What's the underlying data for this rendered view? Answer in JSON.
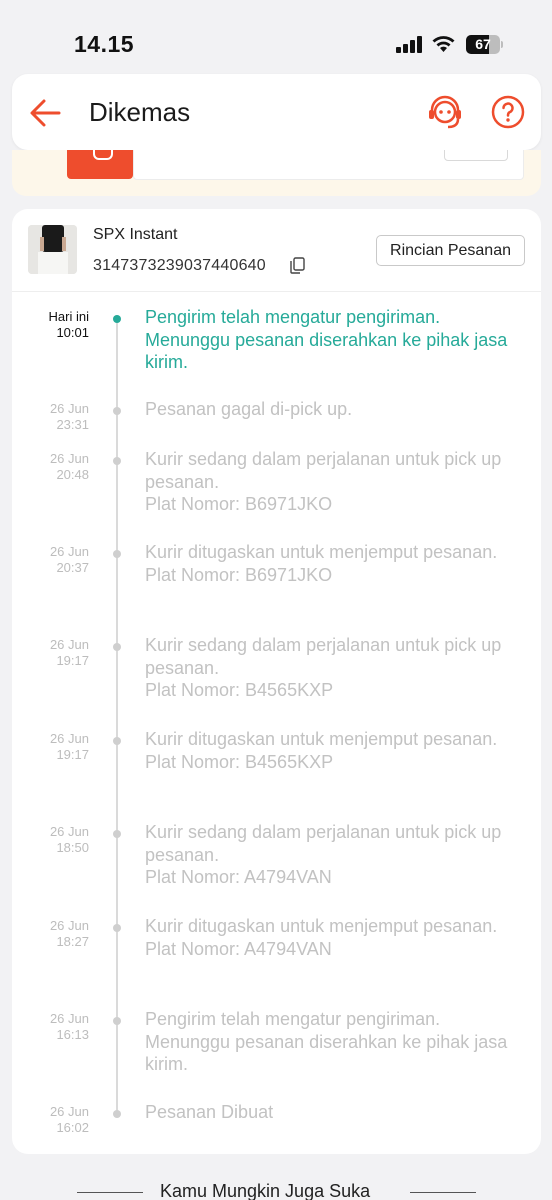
{
  "status_bar": {
    "time": "14.15",
    "battery": "67"
  },
  "header": {
    "title": "Dikemas",
    "icons": [
      "back-arrow-icon",
      "customer-service-icon",
      "help-icon"
    ]
  },
  "shipment": {
    "courier": "SPX Instant",
    "tracking_number": "3147373239037440640",
    "detail_button": "Rincian Pesanan"
  },
  "timeline": [
    {
      "date": "Hari ini",
      "time": "10:01",
      "text": "Pengirim telah mengatur pengiriman. Menunggu pesanan diserahkan ke pihak jasa kirim.",
      "active": true
    },
    {
      "date": "26 Jun",
      "time": "23:31",
      "text": "Pesanan gagal di-pick up.",
      "active": false
    },
    {
      "date": "26 Jun",
      "time": "20:48",
      "text": "Kurir sedang dalam perjalanan untuk pick up pesanan.\nPlat Nomor: B6971JKO",
      "active": false
    },
    {
      "date": "26 Jun",
      "time": "20:37",
      "text": "Kurir ditugaskan untuk menjemput pesanan.\nPlat Nomor: B6971JKO",
      "active": false
    },
    {
      "date": "26 Jun",
      "time": "19:17",
      "text": "Kurir sedang dalam perjalanan untuk pick up pesanan.\nPlat Nomor: B4565KXP",
      "active": false
    },
    {
      "date": "26 Jun",
      "time": "19:17",
      "text": "Kurir ditugaskan untuk menjemput pesanan.\nPlat Nomor: B4565KXP",
      "active": false
    },
    {
      "date": "26 Jun",
      "time": "18:50",
      "text": "Kurir sedang dalam perjalanan untuk pick up pesanan.\nPlat Nomor: A4794VAN",
      "active": false
    },
    {
      "date": "26 Jun",
      "time": "18:27",
      "text": "Kurir ditugaskan untuk menjemput pesanan.\nPlat Nomor: A4794VAN",
      "active": false
    },
    {
      "date": "26 Jun",
      "time": "16:13",
      "text": "Pengirim telah mengatur pengiriman. Menunggu pesanan diserahkan ke pihak jasa kirim.",
      "active": false
    },
    {
      "date": "26 Jun",
      "time": "16:02",
      "text": "Pesanan Dibuat",
      "active": false
    }
  ],
  "footer": {
    "title": "Kamu Mungkin Juga Suka"
  },
  "colors": {
    "brand": "#ee4d2d",
    "active": "#26aa99",
    "inactive_text": "#c2c2c2"
  }
}
